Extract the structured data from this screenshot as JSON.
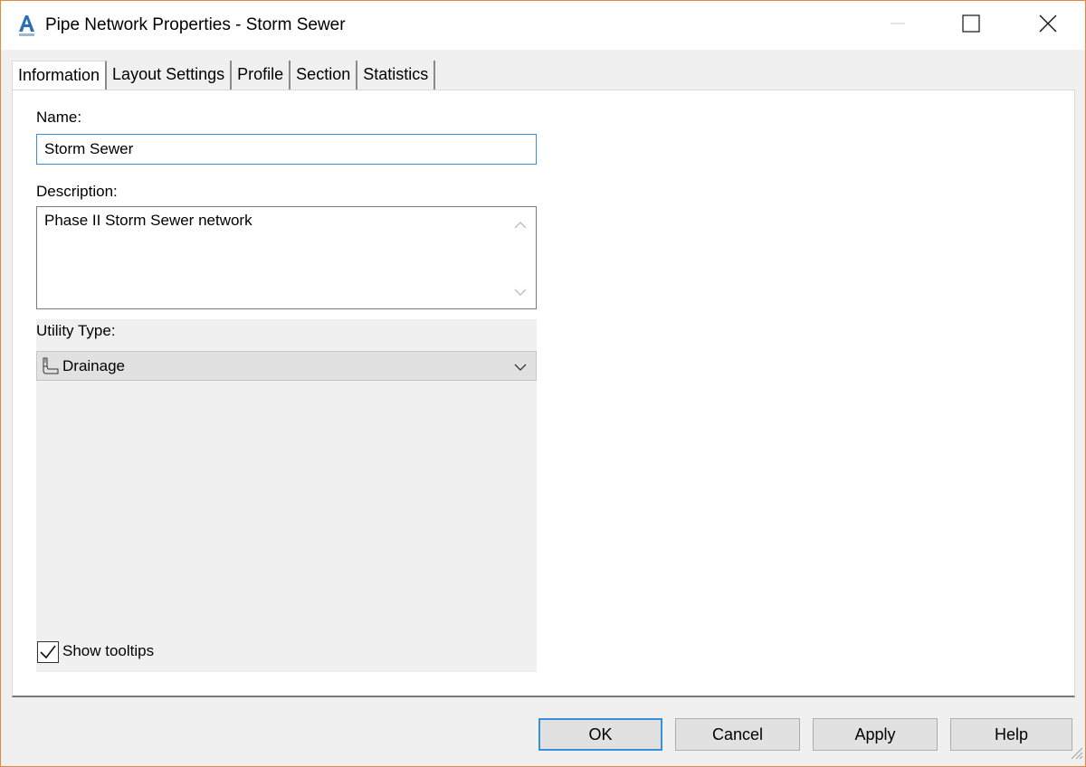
{
  "window": {
    "title": "Pipe Network Properties - Storm Sewer",
    "app_icon": "autocad-civil-icon",
    "controls": {
      "minimize": "minimize-icon",
      "maximize": "maximize-icon",
      "close": "close-icon"
    }
  },
  "tabs": [
    {
      "label": "Information",
      "active": true
    },
    {
      "label": "Layout Settings",
      "active": false
    },
    {
      "label": "Profile",
      "active": false
    },
    {
      "label": "Section",
      "active": false
    },
    {
      "label": "Statistics",
      "active": false
    }
  ],
  "form": {
    "name_label": "Name:",
    "name_value": "Storm Sewer",
    "description_label": "Description:",
    "description_value": "Phase II Storm Sewer network",
    "utility_type_label": "Utility Type:",
    "utility_type_value": "Drainage",
    "utility_type_icon": "drainage-icon",
    "show_tooltips_label": "Show tooltips",
    "show_tooltips_checked": true
  },
  "buttons": {
    "ok": "OK",
    "cancel": "Cancel",
    "apply": "Apply",
    "help": "Help"
  },
  "colors": {
    "accent": "#3a8fd8",
    "window_border": "#e8863a",
    "app_icon": "#2a6fb5"
  }
}
